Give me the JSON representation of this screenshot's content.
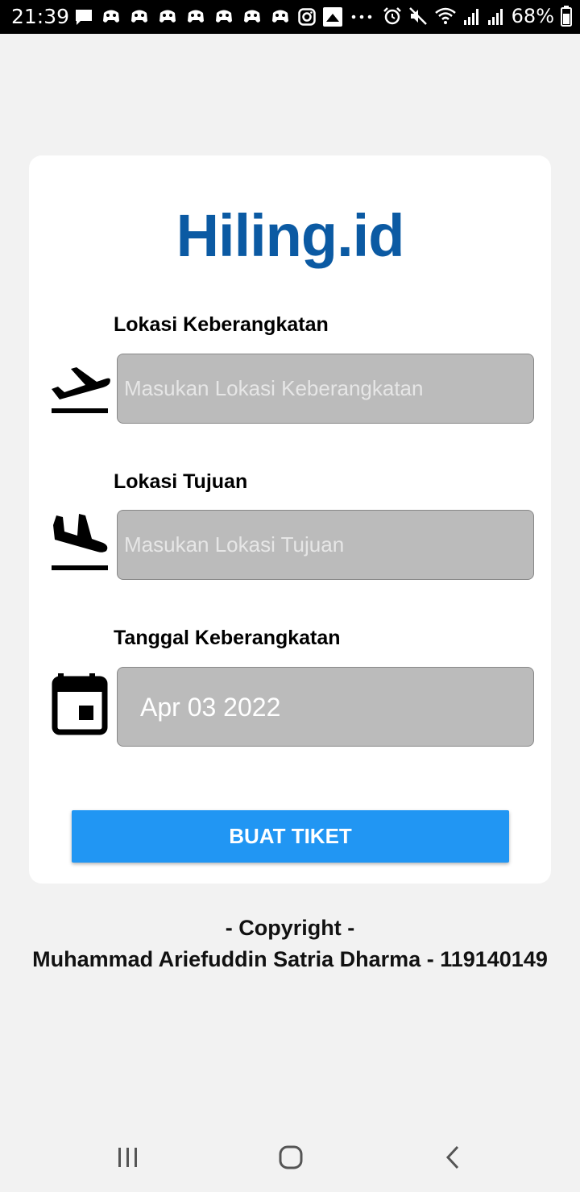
{
  "status_bar": {
    "time": "21:39",
    "battery": "68%",
    "notification_icons": [
      "chat-icon",
      "game-icon",
      "game-icon",
      "game-icon",
      "game-icon",
      "game-icon",
      "game-icon",
      "game-icon",
      "instagram-icon",
      "image-icon",
      "more-icon"
    ],
    "status_icons": [
      "alarm-icon",
      "mute-icon",
      "wifi-icon",
      "signal-icon",
      "signal-icon",
      "battery-icon"
    ]
  },
  "app": {
    "brand": "Hiling.id",
    "brand_color": "#0b5aa3"
  },
  "form": {
    "departure": {
      "label": "Lokasi Keberangkatan",
      "placeholder": "Masukan Lokasi Keberangkatan",
      "value": "",
      "icon": "flight-takeoff-icon"
    },
    "destination": {
      "label": "Lokasi Tujuan",
      "placeholder": "Masukan Lokasi Tujuan",
      "value": "",
      "icon": "flight-land-icon"
    },
    "date": {
      "label": "Tanggal Keberangkatan",
      "value": "Apr 03 2022",
      "icon": "calendar-icon"
    },
    "submit_label": "BUAT TIKET",
    "submit_color": "#2196f3"
  },
  "footer": {
    "copyright": "- Copyright -",
    "author": "Muhammad Ariefuddin Satria Dharma - 119140149"
  },
  "navbar": {
    "buttons": [
      "recent-apps-icon",
      "home-icon",
      "back-icon"
    ]
  }
}
